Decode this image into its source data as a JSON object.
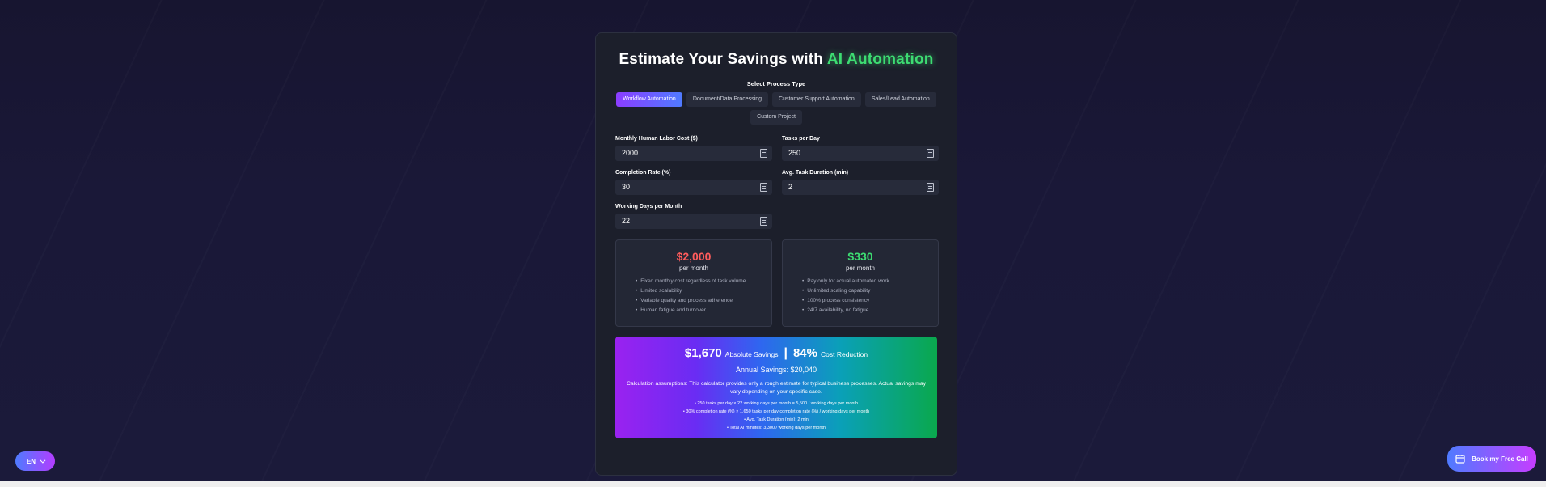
{
  "title": {
    "prefix": "Estimate Your Savings with",
    "accent": "AI Automation"
  },
  "process": {
    "label": "Select Process Type",
    "tabs": [
      {
        "label": "Workflow Automation",
        "active": true
      },
      {
        "label": "Document/Data Processing",
        "active": false
      },
      {
        "label": "Customer Support Automation",
        "active": false
      },
      {
        "label": "Sales/Lead Automation",
        "active": false
      },
      {
        "label": "Custom Project",
        "active": false
      }
    ]
  },
  "fields": {
    "labor_cost": {
      "label": "Monthly Human Labor Cost ($)",
      "value": "2000"
    },
    "tasks_per_day": {
      "label": "Tasks per Day",
      "value": "250"
    },
    "completion_rate": {
      "label": "Completion Rate (%)",
      "value": "30"
    },
    "task_duration": {
      "label": "Avg. Task Duration (min)",
      "value": "2"
    },
    "working_days": {
      "label": "Working Days per Month",
      "value": "22"
    }
  },
  "human": {
    "price": "$2,000",
    "period": "per month",
    "bullets": [
      "Fixed monthly cost regardless of task volume",
      "Limited scalability",
      "Variable quality and process adherence",
      "Human fatigue and turnover"
    ]
  },
  "ai": {
    "price": "$330",
    "period": "per month",
    "bullets": [
      "Pay only for actual automated work",
      "Unlimited scaling capability",
      "100% process consistency",
      "24/7 availability, no fatigue"
    ]
  },
  "savings": {
    "absolute_value": "$1,670",
    "absolute_label": "Absolute Savings",
    "separator": "|",
    "reduction_value": "84%",
    "reduction_label": "Cost Reduction",
    "annual": "Annual Savings: $20,040",
    "assumptions": "Calculation assumptions: This calculator provides only a rough estimate for typical business processes. Actual savings may vary depending on your specific case.",
    "lines": [
      "• 250 tasks per day × 22 working days per month = 5,500 / working days per month",
      "• 30% completion rate (%) × 1,650 tasks per day completion rate (%) / working days per month",
      "• Avg. Task Duration (min): 2 min",
      "• Total AI minutes: 3,300 / working days per month"
    ]
  },
  "lang": {
    "label": "EN"
  },
  "cta": {
    "label": "Book my Free Call"
  },
  "colors": {
    "accent_green": "#3ddc72",
    "cost_red": "#ff5c5c",
    "tab_active_start": "#8b3dff",
    "tab_active_end": "#4f7bff"
  }
}
